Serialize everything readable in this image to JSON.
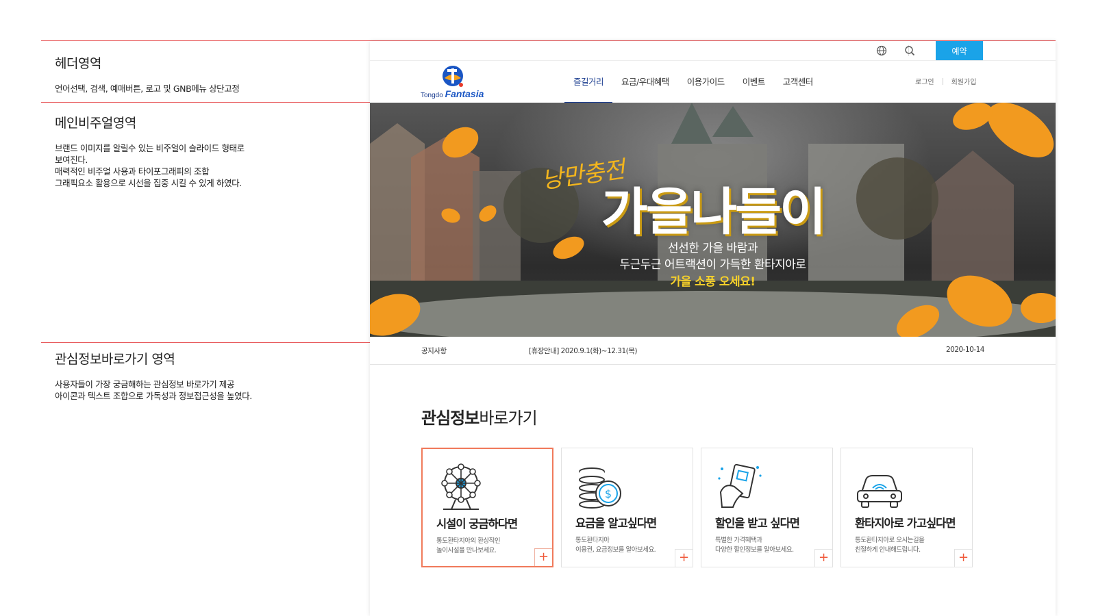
{
  "annotations": [
    {
      "title": "헤더영역",
      "lines": [
        "언어선택, 검색, 예매버튼, 로고 및 GNB메뉴 상단고정"
      ]
    },
    {
      "title": "메인비주얼영역",
      "lines": [
        "브랜드 이미지를 알릴수 있는 비주얼이 슬라이드 형태로",
        "보여진다.",
        "매력적인 비주얼 사용과 타이포그래피의 조합",
        "그래픽요소 활용으로 시선을 집중 시킬 수 있게 하였다."
      ]
    },
    {
      "title": "관심정보바로가기 영역",
      "lines": [
        "사용자들이 가장 궁금해하는 관심정보 바로가기 제공",
        "아이콘과 텍스트 조합으로 가독성과 정보접근성을 높였다."
      ]
    }
  ],
  "header": {
    "reserve_label": "예약",
    "logo": {
      "small": "Tongdo",
      "big": "Fantasia"
    },
    "gnb": [
      "즐길거리",
      "요금/우대혜택",
      "이용가이드",
      "이벤트",
      "고객센터"
    ],
    "login": "로그인",
    "signup": "회원가입"
  },
  "hero": {
    "script": "낭만충전",
    "title": "가을나들이",
    "sub1": "선선한 가을 바람과",
    "sub2": "두근두근 어트랙션이 가득한 환타지아로",
    "sub3": "가을 소풍 오세요!"
  },
  "notice": {
    "label": "공지사항",
    "text": "[휴장안내] 2020.9.1(화)~12.31(목)",
    "date": "2020-10-14"
  },
  "quick": {
    "title_bold": "관심정보",
    "title_light": "바로가기",
    "cards": [
      {
        "icon": "ferris-wheel-icon",
        "title": "시설이 궁금하다면",
        "desc1": "통도환타지아의 환상적인",
        "desc2": "놀이시설을 만나보세요."
      },
      {
        "icon": "coins-icon",
        "title": "요금을 알고싶다면",
        "desc1": "통도환타지아",
        "desc2": "이용권, 요금정보를 알아보세요."
      },
      {
        "icon": "discount-card-icon",
        "title": "할인을 받고 싶다면",
        "desc1": "특별한 가격혜택과",
        "desc2": "다양한 할인정보를 알아보세요."
      },
      {
        "icon": "car-icon",
        "title": "환타지아로 가고싶다면",
        "desc1": "통도환타지아로 오시는길을",
        "desc2": "친절하게 안내해드립니다."
      }
    ],
    "plus": "+"
  },
  "colors": {
    "accent": "#1aa3e8",
    "nav_active": "#1a3c8f",
    "guide_line": "#e8595b",
    "card_active": "#f07a5b",
    "hero_yellow": "#f6d12a"
  }
}
